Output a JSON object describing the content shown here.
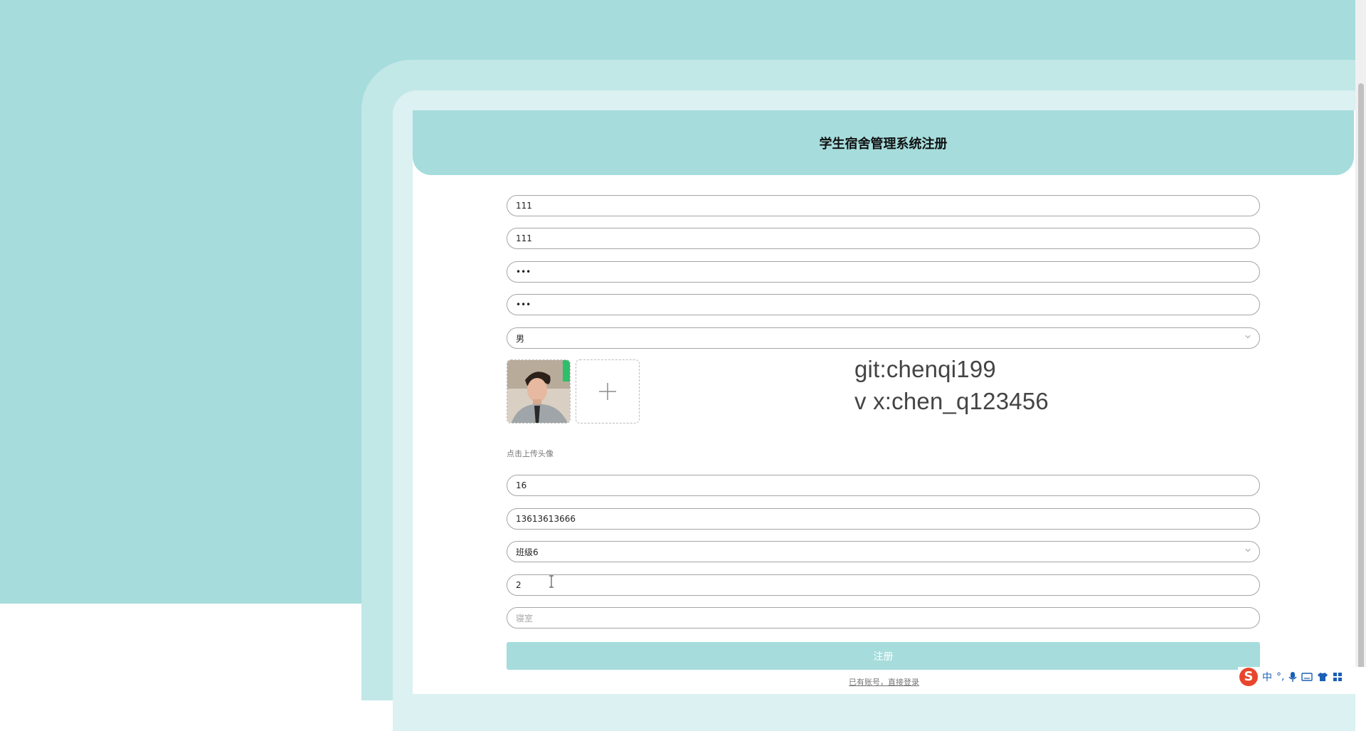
{
  "page": {
    "title": "学生宿舍管理系统注册"
  },
  "form": {
    "username": "111",
    "name": "111",
    "password": "•••",
    "confirm_password": "•••",
    "gender": "男",
    "upload_hint": "点击上传头像",
    "age": "16",
    "phone": "13613613666",
    "class": "班级6",
    "building": "2",
    "dorm_placeholder": "寝室",
    "submit_label": "注册",
    "login_link": "已有账号，直接登录"
  },
  "overlay": {
    "line1": "git:chenqi199",
    "line2": "v x:chen_q123456"
  },
  "ime": {
    "mode": "中",
    "punct": "°,"
  },
  "colors": {
    "accent": "#a6dcdc",
    "frame_outer": "#c2e7e7",
    "frame_inner": "#dcf1f1"
  }
}
